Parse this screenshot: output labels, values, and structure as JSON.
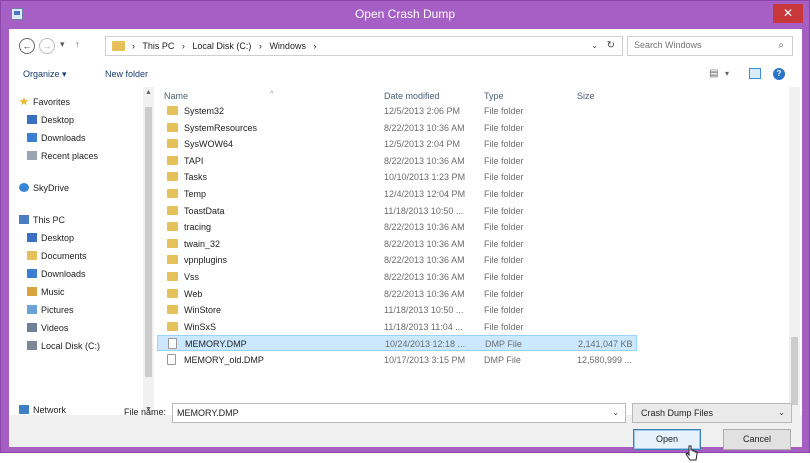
{
  "window": {
    "title": "Open Crash Dump",
    "close_glyph": "✕"
  },
  "address": {
    "back_glyph": "←",
    "forward_glyph": "→",
    "recent_glyph": "▾",
    "up_glyph": "↑",
    "crumbs": [
      "›",
      "This PC",
      "›",
      "Local Disk (C:)",
      "›",
      "Windows",
      "›"
    ],
    "dropdown_glyph": "⌄",
    "refresh_glyph": "↻"
  },
  "search": {
    "placeholder": "Search Windows",
    "icon_glyph": "⌕"
  },
  "toolbar": {
    "organize": "Organize ▾",
    "new_folder": "New folder",
    "view_glyph": "▤",
    "view_dd": "▾",
    "help": "?"
  },
  "navpane": {
    "items": [
      {
        "label": "Favorites",
        "icon": "star-icon"
      },
      {
        "label": "Desktop",
        "icon": "desktop-icon"
      },
      {
        "label": "Downloads",
        "icon": "downloads-icon"
      },
      {
        "label": "Recent places",
        "icon": "recent-places-icon"
      },
      {
        "label": "SkyDrive",
        "icon": "skydrive-icon"
      },
      {
        "label": "This PC",
        "icon": "computer-icon"
      },
      {
        "label": "Desktop",
        "icon": "desktop-icon"
      },
      {
        "label": "Documents",
        "icon": "documents-icon"
      },
      {
        "label": "Downloads",
        "icon": "downloads-icon"
      },
      {
        "label": "Music",
        "icon": "music-icon"
      },
      {
        "label": "Pictures",
        "icon": "pictures-icon"
      },
      {
        "label": "Videos",
        "icon": "videos-icon"
      },
      {
        "label": "Local Disk (C:)",
        "icon": "disk-icon"
      },
      {
        "label": "Network",
        "icon": "network-icon"
      }
    ],
    "scroll_up": "▲",
    "scroll_down": "▼"
  },
  "filelist": {
    "columns": {
      "name": "Name",
      "date": "Date modified",
      "type": "Type",
      "size": "Size"
    },
    "sort_glyph": "^",
    "rows": [
      {
        "name": "System32",
        "date": "12/5/2013 2:06 PM",
        "type": "File folder",
        "size": "",
        "kind": "folder"
      },
      {
        "name": "SystemResources",
        "date": "8/22/2013 10:36 AM",
        "type": "File folder",
        "size": "",
        "kind": "folder"
      },
      {
        "name": "SysWOW64",
        "date": "12/5/2013 2:04 PM",
        "type": "File folder",
        "size": "",
        "kind": "folder"
      },
      {
        "name": "TAPI",
        "date": "8/22/2013 10:36 AM",
        "type": "File folder",
        "size": "",
        "kind": "folder"
      },
      {
        "name": "Tasks",
        "date": "10/10/2013 1:23 PM",
        "type": "File folder",
        "size": "",
        "kind": "folder"
      },
      {
        "name": "Temp",
        "date": "12/4/2013 12:04 PM",
        "type": "File folder",
        "size": "",
        "kind": "folder"
      },
      {
        "name": "ToastData",
        "date": "11/18/2013 10:50 ...",
        "type": "File folder",
        "size": "",
        "kind": "folder"
      },
      {
        "name": "tracing",
        "date": "8/22/2013 10:36 AM",
        "type": "File folder",
        "size": "",
        "kind": "folder"
      },
      {
        "name": "twain_32",
        "date": "8/22/2013 10:36 AM",
        "type": "File folder",
        "size": "",
        "kind": "folder"
      },
      {
        "name": "vpnplugins",
        "date": "8/22/2013 10:36 AM",
        "type": "File folder",
        "size": "",
        "kind": "folder"
      },
      {
        "name": "Vss",
        "date": "8/22/2013 10:36 AM",
        "type": "File folder",
        "size": "",
        "kind": "folder"
      },
      {
        "name": "Web",
        "date": "8/22/2013 10:36 AM",
        "type": "File folder",
        "size": "",
        "kind": "folder"
      },
      {
        "name": "WinStore",
        "date": "11/18/2013 10:50 ...",
        "type": "File folder",
        "size": "",
        "kind": "folder"
      },
      {
        "name": "WinSxS",
        "date": "11/18/2013 11:04 ...",
        "type": "File folder",
        "size": "",
        "kind": "folder"
      },
      {
        "name": "MEMORY.DMP",
        "date": "10/24/2013 12:18 ...",
        "type": "DMP File",
        "size": "2,141,047 KB",
        "kind": "file",
        "selected": true
      },
      {
        "name": "MEMORY_old.DMP",
        "date": "10/17/2013 3:15 PM",
        "type": "DMP File",
        "size": "12,580,999 ...",
        "kind": "file"
      }
    ]
  },
  "bottom": {
    "file_name_label": "File name:",
    "file_name_value": "MEMORY.DMP",
    "filter_value": "Crash Dump Files",
    "open_label": "Open",
    "cancel_label": "Cancel",
    "dd_glyph": "⌄"
  }
}
